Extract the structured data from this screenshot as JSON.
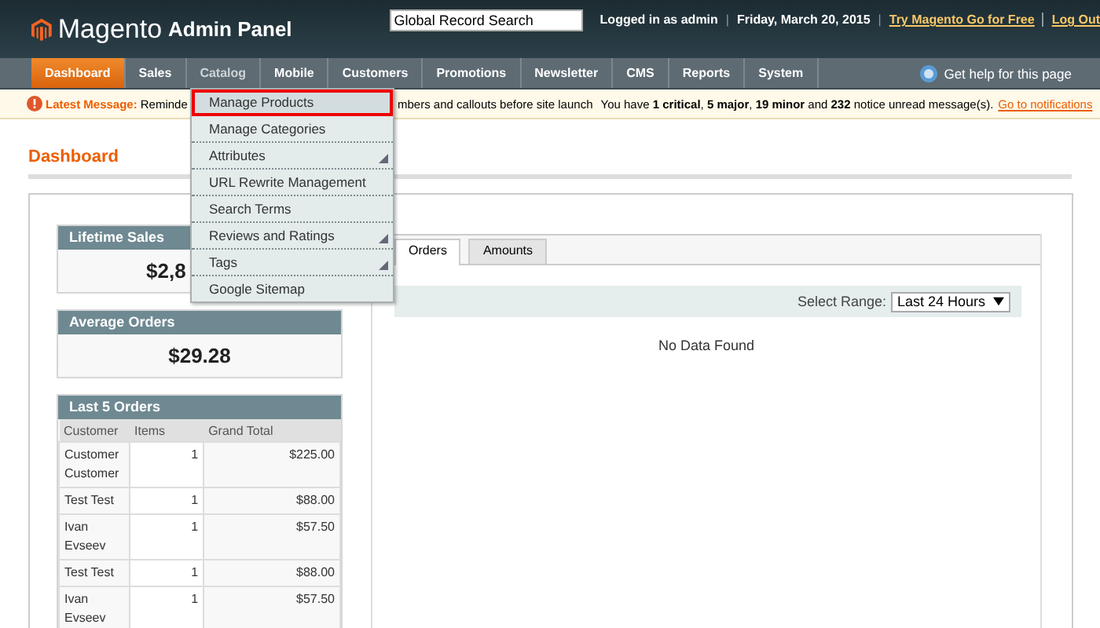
{
  "header": {
    "logo_name": "Magento",
    "logo_suffix": "Admin Panel",
    "search": {
      "value": "Global Record Search"
    },
    "user": "Logged in as admin",
    "separator_1": "|",
    "date": "Friday, March 20, 2015",
    "separator_2": "|",
    "links": [
      "Try Magento Go for Free",
      "Log Out"
    ]
  },
  "nav": {
    "items": [
      {
        "label": "Dashboard",
        "selected": true,
        "open": false
      },
      {
        "label": "Sales",
        "selected": false,
        "open": false
      },
      {
        "label": "Catalog",
        "selected": false,
        "open": true
      },
      {
        "label": "Mobile",
        "selected": false,
        "open": false
      },
      {
        "label": "Customers",
        "selected": false,
        "open": false
      },
      {
        "label": "Promotions",
        "selected": false,
        "open": false
      },
      {
        "label": "Newsletter",
        "selected": false,
        "open": false
      },
      {
        "label": "CMS",
        "selected": false,
        "open": false
      },
      {
        "label": "Reports",
        "selected": false,
        "open": false
      },
      {
        "label": "System",
        "selected": false,
        "open": false
      }
    ],
    "help": "Get help for this page"
  },
  "catalog_menu": [
    {
      "label": "Manage Products",
      "selected": true,
      "has_submenu": false
    },
    {
      "label": "Manage Categories",
      "selected": false,
      "has_submenu": false
    },
    {
      "label": "Attributes",
      "selected": false,
      "has_submenu": true
    },
    {
      "label": "URL Rewrite Management",
      "selected": false,
      "has_submenu": false
    },
    {
      "label": "Search Terms",
      "selected": false,
      "has_submenu": false
    },
    {
      "label": "Reviews and Ratings",
      "selected": false,
      "has_submenu": true
    },
    {
      "label": "Tags",
      "selected": false,
      "has_submenu": true
    },
    {
      "label": "Google Sitemap",
      "selected": false,
      "has_submenu": false
    }
  ],
  "message": {
    "label": "Latest Message:",
    "text_start": "Reminde",
    "text_end": "mbers and callouts before site launch",
    "counts": "You have **1 critical**, **5 major**, **19 minor** and **232** notice unread message(s).",
    "link": "Go to notifications"
  },
  "page_title": "Dashboard",
  "lifetime_sales": {
    "title": "Lifetime Sales",
    "value": "$2,8"
  },
  "average_orders": {
    "title": "Average Orders",
    "value": "$29.28"
  },
  "last_orders": {
    "title": "Last 5 Orders",
    "columns": [
      "Customer",
      "Items",
      "Grand Total"
    ],
    "rows": [
      [
        "Customer Customer",
        "1",
        "$225.00"
      ],
      [
        "Test Test",
        "1",
        "$88.00"
      ],
      [
        "Ivan Evseev",
        "1",
        "$57.50"
      ],
      [
        "Test Test",
        "1",
        "$88.00"
      ],
      [
        "Ivan Evseev",
        "1",
        "$57.50"
      ]
    ]
  },
  "chart_tabs": [
    {
      "label": "Orders",
      "selected": true
    },
    {
      "label": "Amounts",
      "selected": false
    }
  ],
  "range": {
    "label": "Select Range:",
    "value": "Last 24 Hours"
  },
  "empty_text": "No Data Found"
}
